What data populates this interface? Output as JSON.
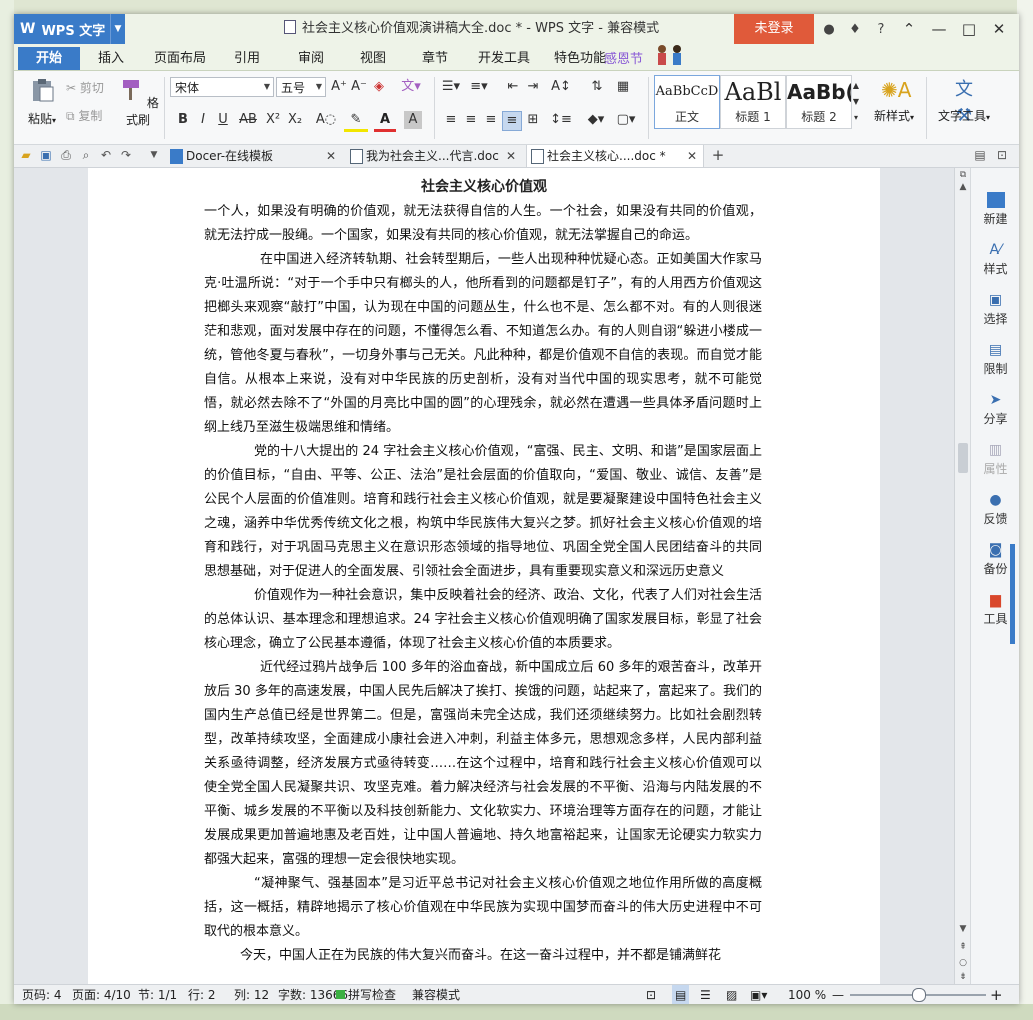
{
  "app": {
    "name": "WPS 文字",
    "window_title": "社会主义核心价值观演讲稿大全.doc * - WPS 文字 - 兼容模式",
    "login_label": "未登录"
  },
  "menu_tabs": [
    "开始",
    "插入",
    "页面布局",
    "引用",
    "审阅",
    "视图",
    "章节",
    "开发工具",
    "特色功能"
  ],
  "festival_label": "感恩节",
  "ribbon": {
    "paste": "粘贴",
    "cut": "剪切",
    "copy": "复制",
    "format_painter": "格式刷",
    "font_name": "宋体",
    "font_size": "五号",
    "styles": [
      {
        "sample": "AaBbCcD",
        "name": "正文"
      },
      {
        "sample": "AaBl",
        "name": "标题 1"
      },
      {
        "sample": "AaBb(",
        "name": "标题 2"
      }
    ],
    "new_style": "新样式",
    "text_tools": "文字工具"
  },
  "doc_tabs": [
    {
      "label": "Docer-在线模板"
    },
    {
      "label": "我为社会主义...代言.doc"
    },
    {
      "label": "社会主义核心....doc *"
    }
  ],
  "document": {
    "title": "社会主义核心价值观",
    "paragraphs": [
      "一个人，如果没有明确的价值观，就无法获得自信的人生。一个社会，如果没有共同的价值观，就无法拧成一股绳。一个国家，如果没有共同的核心价值观，就无法掌握自己的命运。",
      "在中国进入经济转轨期、社会转型期后，一些人出现种种忧疑心态。正如美国大作家马克·吐温所说：“对于一个手中只有榔头的人，他所看到的问题都是钉子”，有的人用西方价值观这把榔头来观察“敲打”中国，认为现在中国的问题丛生，什么也不是、怎么都不对。有的人则很迷茫和悲观，面对发展中存在的问题，不懂得怎么看、不知道怎么办。有的人则自诩“躲进小楼成一统，管他冬夏与春秋”，一切身外事与己无关。凡此种种，都是价值观不自信的表现。而自觉才能自信。从根本上来说，没有对中华民族的历史剖析，没有对当代中国的现实思考，就不可能觉悟，就必然去除不了“外国的月亮比中国的圆”的心理残余，就必然在遭遇一些具体矛盾问题时上纲上线乃至滋生极端思维和情绪。",
      "党的十八大提出的 24 字社会主义核心价值观，“富强、民主、文明、和谐”是国家层面上的价值目标，“自由、平等、公正、法治”是社会层面的价值取向，“爱国、敬业、诚信、友善”是公民个人层面的价值准则。培育和践行社会主义核心价值观，就是要凝聚建设中国特色社会主义之魂，涵养中华优秀传统文化之根，构筑中华民族伟大复兴之梦。抓好社会主义核心价值观的培育和践行，对于巩固马克思主义在意识形态领域的指导地位、巩固全党全国人民团结奋斗的共同思想基础，对于促进人的全面发展、引领社会全面进步，具有重要现实意义和深远历史意义",
      "价值观作为一种社会意识，集中反映着社会的经济、政治、文化，代表了人们对社会生活的总体认识、基本理念和理想追求。24 字社会主义核心价值观明确了国家发展目标，彰显了社会核心理念，确立了公民基本遵循，体现了社会主义核心价值的本质要求。",
      "近代经过鸦片战争后 100 多年的浴血奋战，新中国成立后 60 多年的艰苦奋斗，改革开放后 30 多年的高速发展，中国人民先后解决了挨打、挨饿的问题，站起来了，富起来了。我们的国内生产总值已经是世界第二。但是，富强尚未完全达成，我们还须继续努力。比如社会剧烈转型，改革持续攻坚，全面建成小康社会进入冲刺，利益主体多元，思想观念多样，人民内部利益关系亟待调整，经济发展方式亟待转变……在这个过程中，培育和践行社会主义核心价值观可以使全党全国人民凝聚共识、攻坚克难。着力解决经济与社会发展的不平衡、沿海与内陆发展的不平衡、城乡发展的不平衡以及科技创新能力、文化软实力、环境治理等方面存在的问题，才能让发展成果更加普遍地惠及老百姓，让中国人普遍地、持久地富裕起来，让国家无论硬实力软实力都强大起来，富强的理想一定会很快地实现。",
      "“凝神聚气、强基固本”是习近平总书记对社会主义核心价值观之地位作用所做的高度概括，这一概括，精辟地揭示了核心价值观在中华民族为实现中国梦而奋斗的伟大历史进程中不可取代的根本意义。",
      "今天，中国人正在为民族的伟大复兴而奋斗。在这一奋斗过程中，并不都是铺满鲜花"
    ]
  },
  "task_pane": [
    "新建",
    "样式",
    "选择",
    "限制",
    "分享",
    "属性",
    "反馈",
    "备份",
    "工具"
  ],
  "status": {
    "page_num": "页码: 4",
    "pages": "页面: 4/10",
    "section": "节: 1/1",
    "row": "行: 2",
    "col": "列: 12",
    "words": "字数: 13666",
    "spell": "拼写检查",
    "compat": "兼容模式",
    "zoom": "100 %",
    "zoom_fraction": 0.5
  }
}
